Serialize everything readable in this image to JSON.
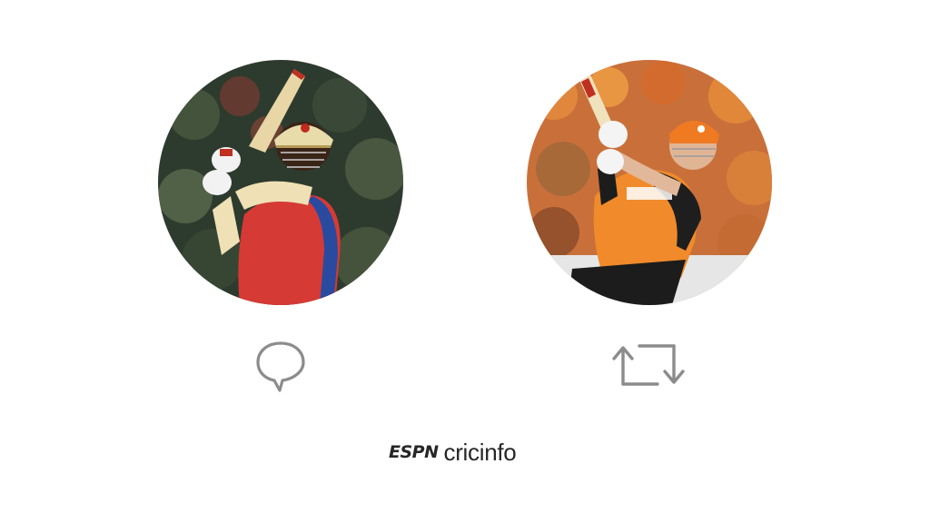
{
  "players": [
    {
      "avatar_icon": "batsman-red-kit-photo"
    },
    {
      "avatar_icon": "batsman-orange-kit-photo"
    }
  ],
  "actions": {
    "reply_icon": "speech-bubble-icon",
    "retweet_icon": "retweet-arrows-icon",
    "icon_color": "#8c8c8c"
  },
  "brand": {
    "espn": "ESPN",
    "cricinfo": "cricinfo",
    "color": "#262626"
  }
}
